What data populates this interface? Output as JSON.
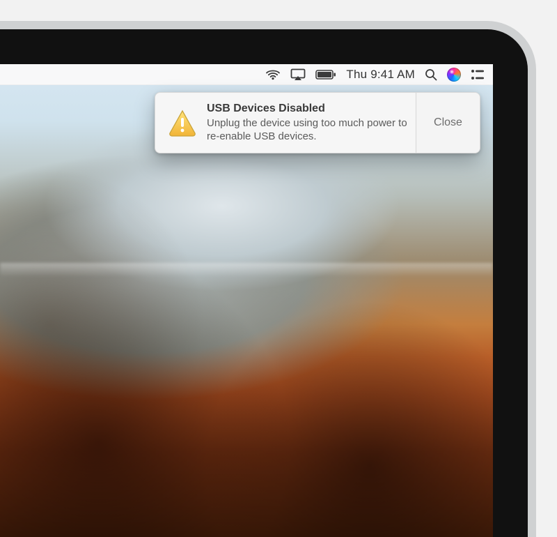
{
  "menubar": {
    "clock": "Thu 9:41 AM",
    "icons": {
      "wifi": "wifi-icon",
      "airplay": "airplay-icon",
      "battery": "battery-icon",
      "search": "search-icon",
      "siri": "siri-icon",
      "notification_center": "notification-center-icon"
    }
  },
  "notification": {
    "title": "USB Devices Disabled",
    "body": "Unplug the device using too much power to re-enable USB devices.",
    "action_label": "Close",
    "icon": "warning-icon"
  },
  "colors": {
    "menubar_bg": "#f9f9f9",
    "banner_bg": "#f6f6f6",
    "text_primary": "#3a3a3a",
    "text_secondary": "#5a5a5a",
    "warning_yellow": "#f7c948",
    "warning_border": "#caa43a"
  }
}
